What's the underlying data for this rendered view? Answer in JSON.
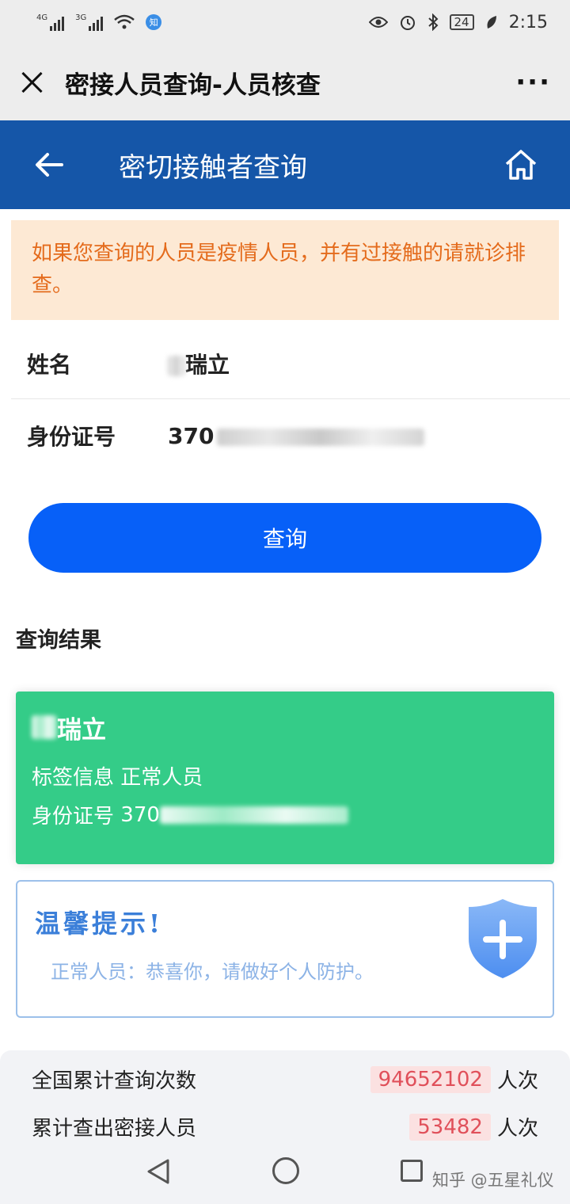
{
  "status_bar": {
    "net1": "4G",
    "net2": "3G",
    "badge": "知",
    "battery": "24",
    "time": "2:15"
  },
  "wechat_bar": {
    "title": "密接人员查询-人员核查",
    "more": "···"
  },
  "header": {
    "title": "密切接触者查询"
  },
  "notice": {
    "text": "如果您查询的人员是疫情人员，并有过接触的请就诊排查。"
  },
  "form": {
    "name_label": "姓名",
    "name_value": "瑞立",
    "id_label": "身份证号",
    "id_value": "370"
  },
  "query_button": {
    "label": "查询"
  },
  "result": {
    "heading": "查询结果",
    "name": "瑞立",
    "tag_label": "标签信息",
    "tag_value": "正常人员",
    "id_label": "身份证号",
    "id_value": "370"
  },
  "tip": {
    "title": "温馨提示!",
    "text": "正常人员：恭喜你，请做好个人防护。"
  },
  "stats": {
    "total_queries_label": "全国累计查询次数",
    "total_queries_value": "94652102",
    "total_queries_unit": "人次",
    "contacts_found_label": "累计查出密接人员",
    "contacts_found_value": "53482",
    "contacts_found_unit": "人次"
  },
  "watermark": "知乎 @五星礼仪",
  "colors": {
    "header_blue": "#1556a8",
    "button_blue": "#0760f8",
    "result_green": "#34cc88",
    "notice_orange": "#e46b1c",
    "notice_bg": "#fde9d4",
    "stat_red": "#e0505a"
  }
}
